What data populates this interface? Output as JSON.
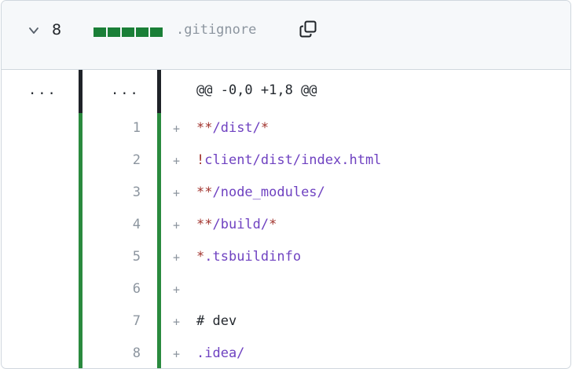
{
  "header": {
    "count": "8",
    "filename": ".gitignore",
    "diffstat_blocks": 5,
    "added_color": "#1a7f37",
    "chevron_icon": "chevron-down-icon",
    "copy_icon": "copy-icon"
  },
  "hunk": {
    "old_dots": "...",
    "new_dots": "...",
    "text": "@@ -0,0 +1,8 @@"
  },
  "lines": [
    {
      "num": "1",
      "sign": "+",
      "segments": [
        {
          "t": "**",
          "c": "red"
        },
        {
          "t": "/dist/",
          "c": "path"
        },
        {
          "t": "*",
          "c": "red"
        }
      ]
    },
    {
      "num": "2",
      "sign": "+",
      "segments": [
        {
          "t": "!",
          "c": "red"
        },
        {
          "t": "client/dist/index.html",
          "c": "path"
        }
      ]
    },
    {
      "num": "3",
      "sign": "+",
      "segments": [
        {
          "t": "**",
          "c": "red"
        },
        {
          "t": "/node_modules/",
          "c": "path"
        }
      ]
    },
    {
      "num": "4",
      "sign": "+",
      "segments": [
        {
          "t": "**",
          "c": "red"
        },
        {
          "t": "/build/",
          "c": "path"
        },
        {
          "t": "*",
          "c": "red"
        }
      ]
    },
    {
      "num": "5",
      "sign": "+",
      "segments": [
        {
          "t": "*",
          "c": "red"
        },
        {
          "t": ".tsbuildinfo",
          "c": "path"
        }
      ]
    },
    {
      "num": "6",
      "sign": "+",
      "segments": []
    },
    {
      "num": "7",
      "sign": "+",
      "segments": [
        {
          "t": "# dev",
          "c": "plain"
        }
      ]
    },
    {
      "num": "8",
      "sign": "+",
      "segments": [
        {
          "t": ".idea/",
          "c": "path"
        }
      ]
    }
  ]
}
